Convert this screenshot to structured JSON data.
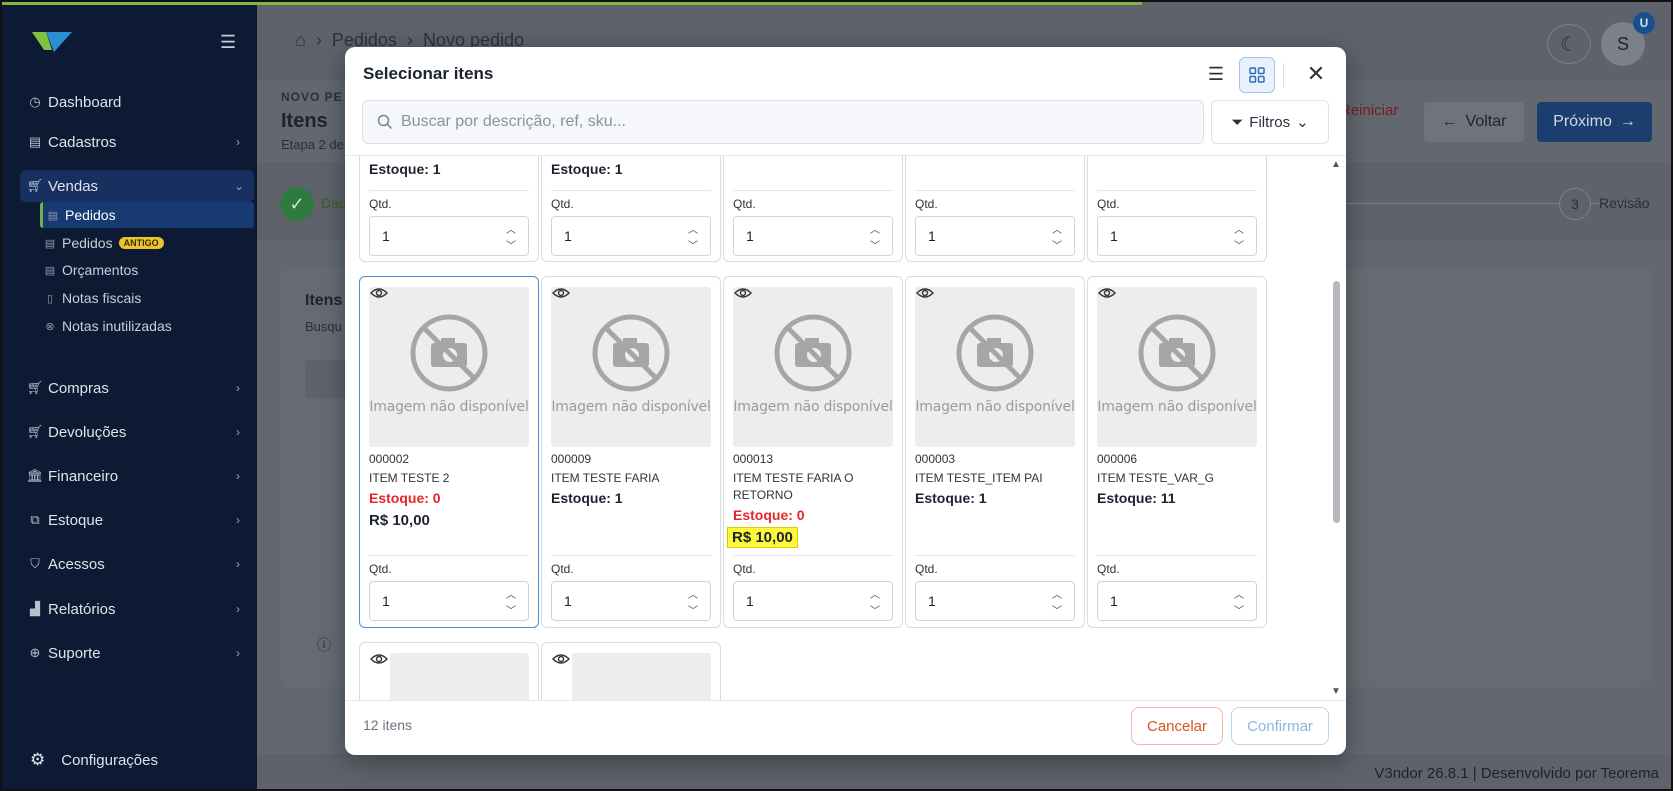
{
  "colors": {
    "sidebar_bg": "#0c1a33",
    "accent_blue": "#1b3e6e",
    "stock_zero": "#e5262b",
    "price_highlight": "#fff83a",
    "cancel": "#d9541e"
  },
  "sidebar": {
    "menu_icon": "hamburger-icon",
    "items": [
      {
        "label": "Dashboard",
        "icon": "gauge-icon"
      },
      {
        "label": "Cadastros",
        "icon": "list-icon"
      },
      {
        "label": "Vendas",
        "icon": "cart-icon"
      },
      {
        "label": "Compras",
        "icon": "cart-icon"
      },
      {
        "label": "Devoluções",
        "icon": "cart-icon"
      },
      {
        "label": "Financeiro",
        "icon": "bank-icon"
      },
      {
        "label": "Estoque",
        "icon": "boxes-icon"
      },
      {
        "label": "Acessos",
        "icon": "shield-icon"
      },
      {
        "label": "Relatórios",
        "icon": "bar-chart-icon"
      },
      {
        "label": "Suporte",
        "icon": "lifebuoy-icon"
      }
    ],
    "sub_items": [
      {
        "label": "Pedidos"
      },
      {
        "label": "Pedidos",
        "badge": "ANTIGO"
      },
      {
        "label": "Orçamentos"
      },
      {
        "label": "Notas fiscais"
      },
      {
        "label": "Notas inutilizadas"
      }
    ],
    "config_label": "Configurações"
  },
  "header": {
    "breadcrumb": [
      "Pedidos",
      "Novo pedido"
    ],
    "avatar_letter": "S",
    "avatar_badge": "U"
  },
  "page": {
    "overline": "NOVO PE",
    "title": "Itens",
    "step_text": "Etapa 2 de",
    "reiniciar": "Reiniciar",
    "voltar": "Voltar",
    "proximo": "Próximo",
    "step1_label": "Dad",
    "step3_number": "3",
    "step3_label": "Revisão",
    "card_title": "Itens",
    "card_sub": "Busqu"
  },
  "footer": {
    "text": "V3ndor  26.8.1  |  Desenvolvido por Teorema"
  },
  "modal": {
    "title": "Selecionar itens",
    "search_placeholder": "Buscar por descrição, ref, sku...",
    "filter_label": "Filtros",
    "qty_label": "Qtd.",
    "image_placeholder": "Imagem não disponível",
    "top_row": [
      {
        "stock": "Estoque: 1",
        "qty": "1"
      },
      {
        "stock": "Estoque: 1",
        "qty": "1"
      },
      {
        "stock": "",
        "qty": "1"
      },
      {
        "stock": "",
        "qty": "1"
      },
      {
        "stock": "",
        "qty": "1"
      }
    ],
    "items": [
      {
        "code": "000002",
        "name": "ITEM TESTE 2",
        "stock": "Estoque: 0",
        "price": "R$ 10,00",
        "qty": "1"
      },
      {
        "code": "000009",
        "name": "ITEM TESTE FARIA",
        "stock": "Estoque: 1",
        "price": "",
        "qty": "1"
      },
      {
        "code": "000013",
        "name": "ITEM TESTE FARIA O RETORNO",
        "stock": "Estoque: 0",
        "price": "R$ 10,00",
        "qty": "1"
      },
      {
        "code": "000003",
        "name": "ITEM TESTE_ITEM PAI",
        "stock": "Estoque: 1",
        "price": "",
        "qty": "1"
      },
      {
        "code": "000006",
        "name": "ITEM TESTE_VAR_G",
        "stock": "Estoque: 11",
        "price": "",
        "qty": "1"
      }
    ],
    "count_text": "12 itens",
    "cancel": "Cancelar",
    "confirm": "Confirmar"
  }
}
